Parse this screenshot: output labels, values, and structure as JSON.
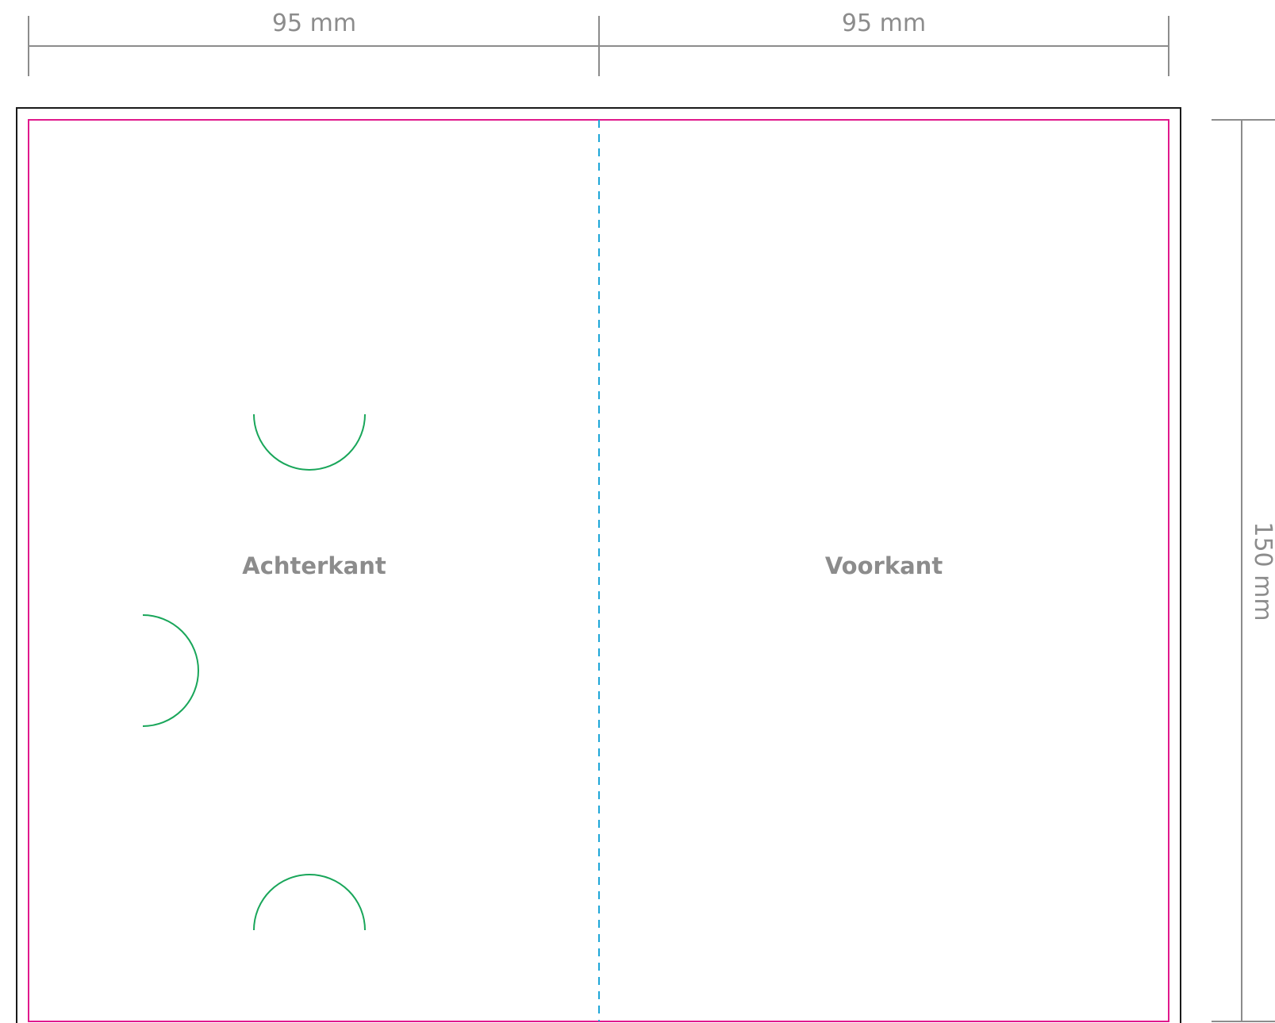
{
  "dimensions": {
    "width_left": "95 mm",
    "width_right": "95 mm",
    "height": "150 mm"
  },
  "panels": {
    "back_label": "Achterkant",
    "front_label": "Voorkant"
  },
  "colors": {
    "dimension_line": "#8c8c8c",
    "dimension_text": "#8c8c8c",
    "outer_border": "#1a1a1a",
    "trim_line": "#e0198c",
    "fold_line": "#1ea6d8",
    "cut_line": "#19a65a",
    "label_text": "#8c8c8c"
  },
  "icons": {
    "fold": "dashed-fold-line",
    "cut": "half-circle-cut-line"
  }
}
